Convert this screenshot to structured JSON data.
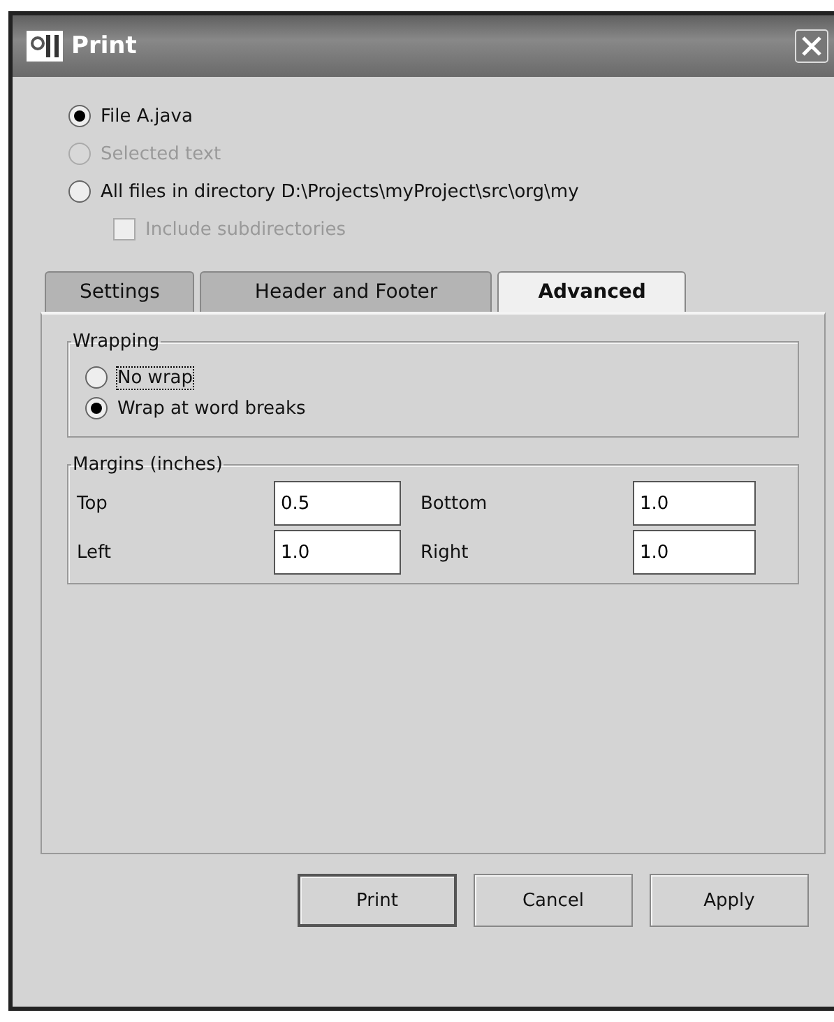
{
  "window": {
    "title": "Print"
  },
  "scope": [
    {
      "label": "File A.java",
      "selected": true,
      "disabled": false
    },
    {
      "label": "Selected text",
      "selected": false,
      "disabled": true
    },
    {
      "label": "All files in directory D:\\Projects\\myProject\\src\\org\\my",
      "selected": false,
      "disabled": false
    }
  ],
  "include_subdirectories": {
    "label": "Include subdirectories",
    "checked": false,
    "disabled": true
  },
  "tabs": [
    {
      "label": "Settings",
      "selected": false
    },
    {
      "label": "Header and Footer",
      "selected": false
    },
    {
      "label": "Advanced",
      "selected": true
    }
  ],
  "wrapping": {
    "title": "Wrapping",
    "options": [
      {
        "label": "No wrap",
        "selected": false,
        "focused": true
      },
      {
        "label": "Wrap at word breaks",
        "selected": true,
        "focused": false
      }
    ]
  },
  "margins": {
    "title": "Margins (inches)",
    "fields": [
      {
        "label": "Top",
        "value": "0.5"
      },
      {
        "label": "Bottom",
        "value": "1.0"
      },
      {
        "label": "Left",
        "value": "1.0"
      },
      {
        "label": "Right",
        "value": "1.0"
      }
    ]
  },
  "buttons": [
    {
      "label": "Print",
      "default": true
    },
    {
      "label": "Cancel",
      "default": false
    },
    {
      "label": "Apply",
      "default": false
    }
  ]
}
